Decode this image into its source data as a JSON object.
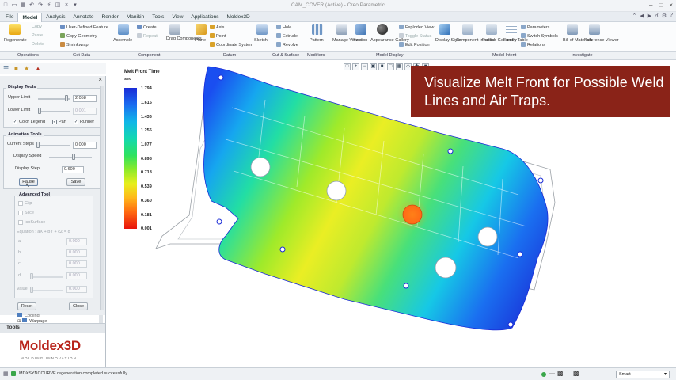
{
  "window": {
    "title": "CAM_COVER (Active) - Creo Parametric"
  },
  "menu": {
    "tabs": [
      "File",
      "Model",
      "Analysis",
      "Annotate",
      "Render",
      "Manikin",
      "Tools",
      "View",
      "Applications",
      "Moldex3D"
    ],
    "active": "Model"
  },
  "ribbon": {
    "regenerate": "Regenerate",
    "copy": "Copy",
    "paste": "Paste",
    "delete": "Delete",
    "user_defined_feature": "User-Defined Feature",
    "copy_geometry": "Copy Geometry",
    "shrinkwrap": "Shrinkwrap",
    "assemble": "Assemble",
    "create": "Create",
    "repeat": "Repeat",
    "drag_components": "Drag Components",
    "plane": "Plane",
    "axis": "Axis",
    "point": "Point",
    "coordinate_system": "Coordinate System",
    "sketch": "Sketch",
    "hole": "Hole",
    "extrude": "Extrude",
    "revolve": "Revolve",
    "pattern": "Pattern",
    "manage_views": "Manage Views",
    "section": "Section",
    "appearance_gallery": "Appearance Gallery",
    "exploded_view": "Exploded View",
    "toggle_status": "Toggle Status",
    "edit_position": "Edit Position",
    "display_style": "Display Style",
    "component_interface": "Component Interface",
    "publish_geometry": "Publish Geometry",
    "family_table": "Family Table",
    "parameters": "Parameters",
    "switch_symbols": "Switch Symbols",
    "relations": "Relations",
    "bill_of_materials": "Bill of Materials",
    "reference_viewer": "Reference Viewer"
  },
  "groups": [
    "Operations",
    "Get Data",
    "Component",
    "Datum",
    "Cut & Surface",
    "Modifiers",
    "Model Display",
    "Model Intent",
    "Investigate"
  ],
  "panel": {
    "display_tools": {
      "title": "Display Tools",
      "upper_label": "Upper Limit",
      "upper_value": "2.058",
      "lower_label": "Lower Limit",
      "lower_value": "0.001",
      "color_legend": "Color Legend",
      "part": "Part",
      "runner": "Runner"
    },
    "animation_tools": {
      "title": "Animation Tools",
      "current_step_label": "Current Steps",
      "current_step_value": "0.000",
      "display_speed_label": "Display Speed",
      "display_step_label": "Display Step",
      "display_step_value": "0.600",
      "pause": "Pause",
      "save": "Save"
    },
    "advanced_tool": {
      "title": "Advanced Tool",
      "clip": "Clip",
      "slice": "Slice",
      "isosurface": "IsoSurface",
      "equation": "Equation : aX + bY + cZ = d",
      "a_label": "a",
      "b_label": "b",
      "c_label": "c",
      "d_label": "d",
      "a_value": "0.000",
      "b_value": "0.000",
      "c_value": "0.000",
      "d_value": "0.000",
      "value_label": "Value",
      "value_value": "0.000",
      "reset": "Reset",
      "close": "Close"
    }
  },
  "tree": {
    "items": [
      "Cooling",
      "Warpage"
    ]
  },
  "tools_label": "Tools",
  "logo": {
    "brand": "Moldex3D",
    "tagline": "MOLDING INNOVATION"
  },
  "legend": {
    "title": "Melt Front Time",
    "unit": "sec",
    "ticks": [
      "1.794",
      "1.615",
      "1.436",
      "1.256",
      "1.077",
      "0.898",
      "0.718",
      "0.539",
      "0.360",
      "0.181",
      "0.001"
    ]
  },
  "banner": {
    "text": "Visualize Melt Front for Possible Weld Lines and Air Traps."
  },
  "status": {
    "message": "MDXSYNCCURVE regeneration completed successfully.",
    "filter": "Smart"
  },
  "colors": {
    "banner_bg": "#8a2318",
    "legend_max": "#1a2bd6",
    "legend_min": "#e8140c"
  }
}
